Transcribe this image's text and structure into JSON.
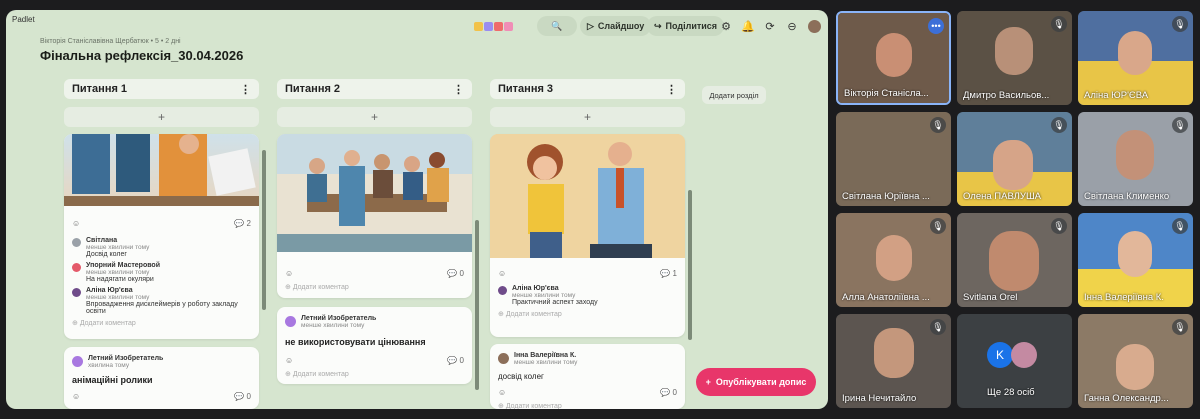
{
  "padlet": {
    "logo": "Padlet",
    "author_line": "Вікторія Станіславівна Щербатюк • 5 • 2 дні",
    "title": "Фінальна рефлексія_30.04.2026",
    "toolbar": {
      "slideshow": "Слайдшоу",
      "share": "Поділитися"
    },
    "add_section": "Додати розділ",
    "publish_button": "Опублікувати допис",
    "add_comment": "Додати коментар",
    "columns": [
      {
        "title": "Питання 1",
        "cards": [
          {
            "comments_count": "2",
            "comments": [
              {
                "author": "Світлана",
                "time": "менше хвилини тому",
                "text": "Досвід колег"
              },
              {
                "author": "Упорний Мастеровой",
                "time": "менше хвилини тому",
                "text": "На надягати окуляри"
              },
              {
                "author": "Аліна Юр'єва",
                "time": "менше хвилини тому",
                "text": "Впровадження дисклеймерів у роботу закладу освіти"
              }
            ]
          },
          {
            "author": "Летний Изобретатель",
            "time": "хвилина тому",
            "body": "анімаційні ролики",
            "comments_count": "0"
          }
        ]
      },
      {
        "title": "Питання 2",
        "cards": [
          {
            "comments_count": "0"
          },
          {
            "author": "Летний Изобретатель",
            "time": "менше хвилини тому",
            "body": "не використовувати цінювання",
            "comments_count": "0"
          }
        ]
      },
      {
        "title": "Питання 3",
        "cards": [
          {
            "comments_count": "1",
            "comments": [
              {
                "author": "Аліна Юр'єва",
                "time": "менше хвилини тому",
                "text": "Практичний аспект заходу"
              }
            ]
          },
          {
            "author": "Інна Валеріївна К.",
            "time": "менше хвилини тому",
            "body": "досвід колег",
            "comments_count": "0"
          }
        ]
      }
    ]
  },
  "meet": {
    "participants": [
      {
        "name": "Вікторія Станісла...",
        "bg": "#6e5a4a"
      },
      {
        "name": "Дмитро Васильов...",
        "bg": "#5b5145"
      },
      {
        "name": "Аліна ЮР'ЄВА",
        "bg": "#4f6fa0"
      },
      {
        "name": "",
        "bg": "#7a6a58"
      },
      {
        "name": "Олена ПАВЛУША",
        "bg": "#5f7f9a"
      },
      {
        "name": "Світлана Клименко",
        "bg": "#9aa0a8"
      },
      {
        "name": "Світлана Юріївна ...",
        "bg": "#806a56"
      },
      {
        "name": "Svitlana Orel",
        "bg": "#6d6660"
      },
      {
        "name": "Інна Валеріївна К.",
        "bg": "#4e86c8"
      },
      {
        "name": "Алла Анатоліївна ...",
        "bg": "#8a7460"
      },
      {
        "name": "Ще 28 осіб",
        "bg": "#3c4043"
      },
      {
        "name": "Ірина Нечитайло",
        "bg": "#5c5550"
      },
      {
        "name": "Ганна Олександр...",
        "bg": "#8c7a66"
      }
    ],
    "more_initial": "K"
  }
}
